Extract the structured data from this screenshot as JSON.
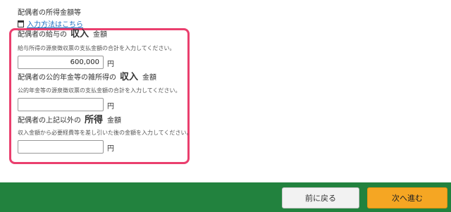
{
  "section": {
    "title": "配偶者の所得金額等",
    "help_link": "入力方法はこちら"
  },
  "fields": [
    {
      "label_pre": "配偶者の給与の",
      "label_em": "収入",
      "label_post": "金額",
      "help": "給与所得の源泉徴収票の支払金額の合計を入力してください。",
      "value": "600,000",
      "unit": "円"
    },
    {
      "label_pre": "配偶者の公的年金等の雑所得の",
      "label_em": "収入",
      "label_post": "金額",
      "help": "公的年金等の源泉徴収票の支払金額の合計を入力してください。",
      "value": "",
      "unit": "円"
    },
    {
      "label_pre": "配偶者の上記以外の",
      "label_em": "所得",
      "label_post": "金額",
      "help": "収入金額から必要経費等を差し引いた後の金額を入力してください。",
      "value": "",
      "unit": "円"
    }
  ],
  "footer": {
    "back_label": "前に戻る",
    "next_label": "次へ進む"
  },
  "colors": {
    "highlight_border": "#ea3f6e",
    "footer_bg": "#22823e",
    "next_button": "#f5a623",
    "link": "#1a6fc1"
  },
  "icons": {
    "help_link_icon": "document-icon"
  }
}
